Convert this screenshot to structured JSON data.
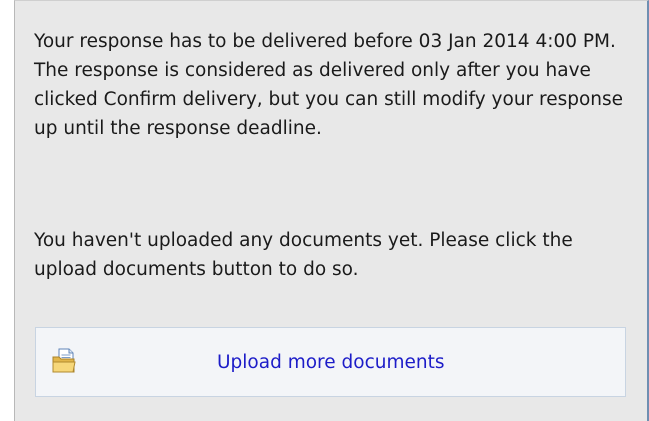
{
  "messages": {
    "deadline": "Your response has to be delivered before 03 Jan 2014 4:00 PM. The response is considered as delivered only after you have clicked Confirm delivery, but you can still modify your response up until the response deadline.",
    "no_documents": "You haven't uploaded any documents yet. Please click the upload documents button to do so."
  },
  "upload_button": {
    "label": "Upload more documents",
    "icon": "folder-document-icon"
  },
  "colors": {
    "panel_background": "#e8e8e8",
    "panel_accent_border": "#6f8fb2",
    "link_text": "#1c1cc8",
    "button_background": "#f3f5f8"
  }
}
